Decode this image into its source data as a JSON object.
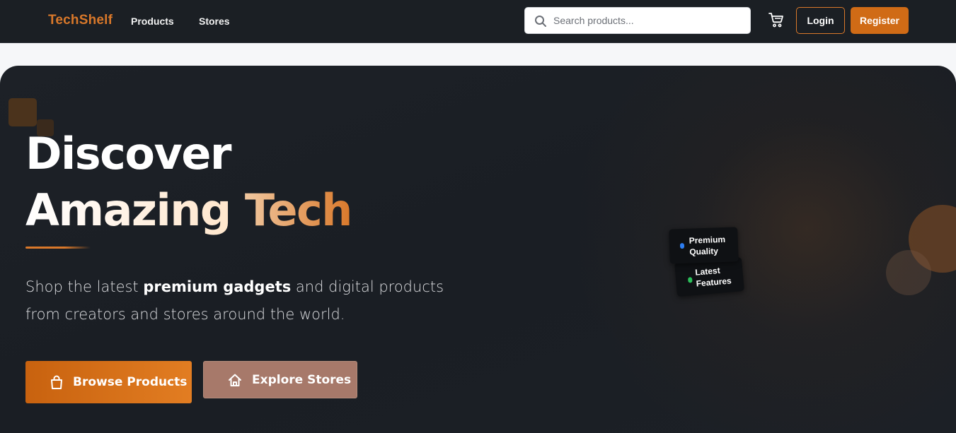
{
  "navbar": {
    "brand": "TechShelf",
    "links": [
      {
        "label": "Products"
      },
      {
        "label": "Stores"
      }
    ],
    "search_placeholder": "Search products...",
    "cart_icon": "cart-icon",
    "login_label": "Login",
    "register_label": "Register"
  },
  "hero": {
    "title_line1": "Discover",
    "title_line2_part1": "Amazing",
    "title_line2_part2": "Tech",
    "subtitle_prefix": "Shop the latest ",
    "subtitle_bold": "premium gadgets",
    "subtitle_suffix": " and digital products from creators and stores around the world.",
    "browse_label": "Browse Products",
    "browse_icon": "shopping-bag-icon",
    "explore_label": "Explore Stores",
    "explore_icon": "home-icon",
    "badges": [
      {
        "label": "Premium Quality",
        "dot_color": "#2d7df0"
      },
      {
        "label": "Latest Features",
        "dot_color": "#2bbf5a"
      }
    ]
  },
  "colors": {
    "accent": "#d9782a",
    "navbar_bg": "#1b1f24",
    "hero_bg": "#1b1f25",
    "explore_button": "#a7796a"
  }
}
